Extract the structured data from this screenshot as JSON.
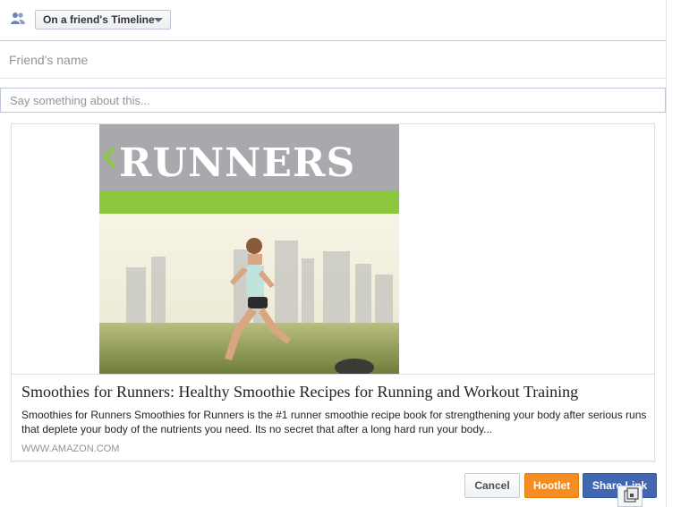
{
  "audience": {
    "selected": "On a friend's Timeline",
    "icon": "friends-icon"
  },
  "friend_field": {
    "placeholder": "Friend's name",
    "value": ""
  },
  "message_field": {
    "placeholder": "Say something about this...",
    "value": ""
  },
  "link_preview": {
    "cover_heading": "RUNNERS",
    "title": "Smoothies for Runners: Healthy Smoothie Recipes for Running and Workout Training",
    "description": "Smoothies for Runners Smoothies for Runners is the #1 runner smoothie recipe book for strengthening your body after serious runs that deplete your body of the nutrients you need. Its no secret that after a long hard run your body...",
    "domain": "WWW.AMAZON.COM"
  },
  "buttons": {
    "cancel": "Cancel",
    "hootlet": "Hootlet",
    "share": "Share Link"
  },
  "colors": {
    "accent_blue": "#4267b2",
    "hootlet_orange": "#f68d20",
    "cover_gray": "#a7a9ac",
    "cover_green": "#8dc63f"
  }
}
